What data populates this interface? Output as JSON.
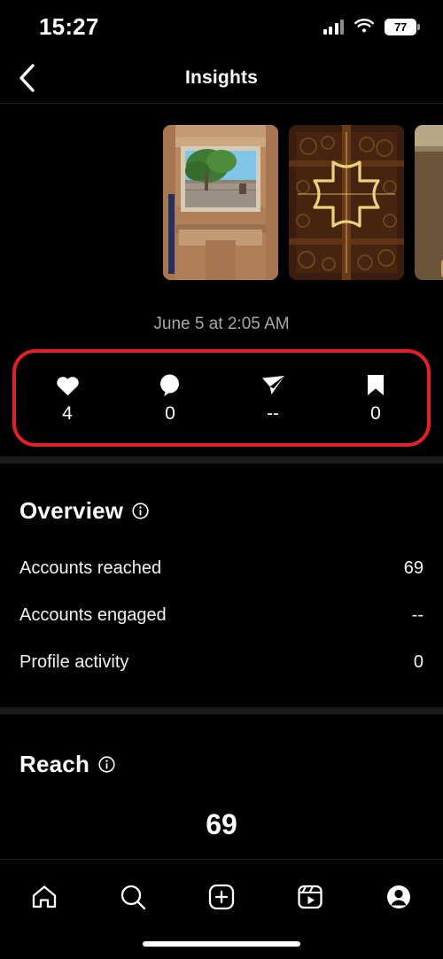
{
  "status_bar": {
    "time": "15:27",
    "battery_percent": "77",
    "cellular_icon": "cellular-signal-icon",
    "wifi_icon": "wifi-icon",
    "battery_icon": "battery-icon"
  },
  "header": {
    "title": "Insights",
    "back_icon": "chevron-left-icon"
  },
  "media": {
    "thumbnails": [
      {
        "alt": "stone-window-tree-castle"
      },
      {
        "alt": "wooden-door-golden-cross"
      },
      {
        "alt": "interior-window-person"
      }
    ]
  },
  "post": {
    "date": "June 5 at 2:05 AM"
  },
  "engagement": {
    "highlight_color": "#e22027",
    "items": [
      {
        "icon": "heart-icon",
        "label": "likes",
        "value": "4"
      },
      {
        "icon": "comment-icon",
        "label": "comments",
        "value": "0"
      },
      {
        "icon": "share-icon",
        "label": "shares",
        "value": "--"
      },
      {
        "icon": "bookmark-icon",
        "label": "saves",
        "value": "0"
      }
    ]
  },
  "overview": {
    "title": "Overview",
    "info_icon": "info-icon",
    "rows": [
      {
        "label": "Accounts reached",
        "value": "69"
      },
      {
        "label": "Accounts engaged",
        "value": "--"
      },
      {
        "label": "Profile activity",
        "value": "0"
      }
    ]
  },
  "reach": {
    "title": "Reach",
    "info_icon": "info-icon",
    "value": "69"
  },
  "tabbar": {
    "items": [
      {
        "icon": "home-icon",
        "label": "Home"
      },
      {
        "icon": "search-icon",
        "label": "Search"
      },
      {
        "icon": "create-icon",
        "label": "Create"
      },
      {
        "icon": "reels-icon",
        "label": "Reels"
      },
      {
        "icon": "profile-icon",
        "label": "Profile"
      }
    ]
  }
}
